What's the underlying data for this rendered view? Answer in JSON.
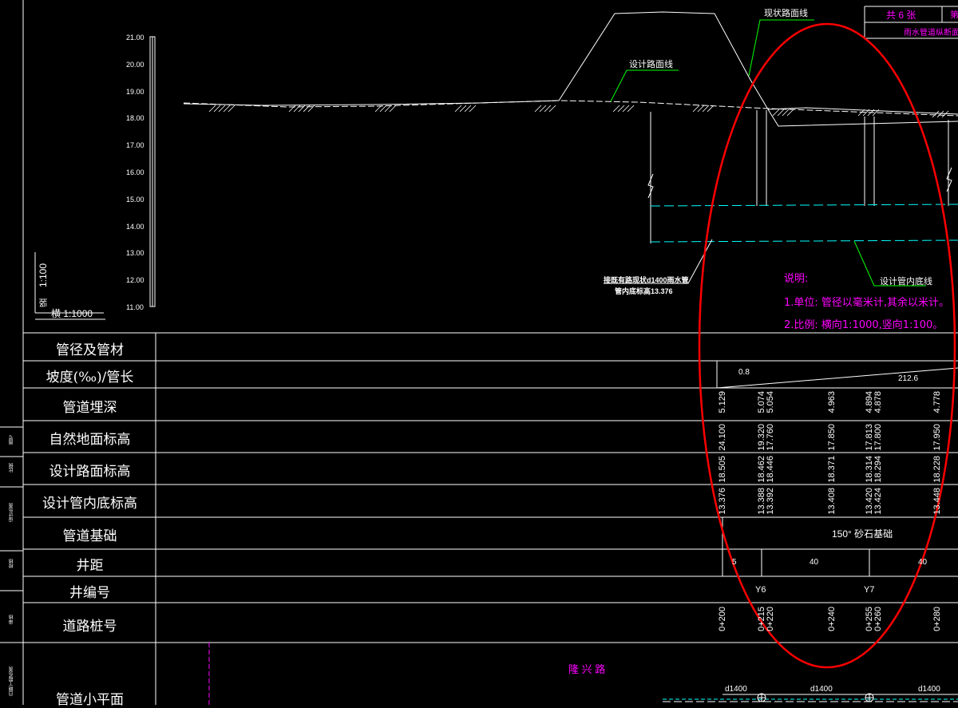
{
  "header": {
    "sheet_count": "共 6 张",
    "sheet_title": "雨水管道纵断面设计图",
    "right_fragment": "第"
  },
  "profile": {
    "existing_road_label": "现状路面线",
    "design_road_label": "设计路面线",
    "design_invert_label": "设计管内底线",
    "scale_v_label": "1:100",
    "scale_v_prefix": "竖",
    "scale_h_label": "横  1:1000",
    "y_ticks": [
      "21.00",
      "20.00",
      "19.00",
      "18.00",
      "17.00",
      "16.00",
      "15.00",
      "14.00",
      "13.00",
      "12.00",
      "11.00"
    ],
    "connection_note_1": "接既有路现状d1400雨水管",
    "connection_note_2": "管内底标高13.376"
  },
  "notes": {
    "title": "说明:",
    "line1": "1.单位: 管径以毫米计,其余以米计。",
    "line2": "2.比例: 横向1:1000,竖向1:100。"
  },
  "table": {
    "rows": [
      {
        "label": "管径及管材"
      },
      {
        "label": "坡度(‰)/管长"
      },
      {
        "label": "管道埋深"
      },
      {
        "label": "自然地面标高"
      },
      {
        "label": "设计路面标高"
      },
      {
        "label": "设计管内底标高"
      },
      {
        "label": "管道基础"
      },
      {
        "label": "井距"
      },
      {
        "label": "井编号"
      },
      {
        "label": "道路桩号"
      },
      {
        "label": "管道小平面"
      }
    ],
    "slope": "0.8",
    "length": "212.6",
    "depth": [
      "5.129",
      "5.074",
      "5.054",
      "4.963",
      "4.894",
      "4.878",
      "4.778"
    ],
    "ground": [
      "24.100",
      "19.320",
      "17.760",
      "17.850",
      "17.813",
      "17.800",
      "17.950"
    ],
    "design_road": [
      "18.505",
      "18.462",
      "18.446",
      "18.371",
      "18.314",
      "18.294",
      "18.228"
    ],
    "invert": [
      "13.376",
      "13.388",
      "13.392",
      "13.408",
      "13.420",
      "13.424",
      "13.448"
    ],
    "foundation": "150° 砂石基础",
    "spacing": [
      "5",
      "40",
      "40"
    ],
    "wells": [
      "Y6",
      "Y7"
    ],
    "stations": [
      "0+200",
      "0+215",
      "0+220",
      "0+240",
      "0+255",
      "0+260",
      "0+280"
    ],
    "road_name": "隆 兴 路",
    "pipe_sizes": [
      "d1400",
      "d1400",
      "d1400"
    ],
    "side_marks": [
      "图号",
      "比例",
      "设计负责",
      "校核",
      "审核",
      "工程负责",
      "日期"
    ]
  },
  "annotation": {
    "ellipse_color": "#ff0000"
  }
}
